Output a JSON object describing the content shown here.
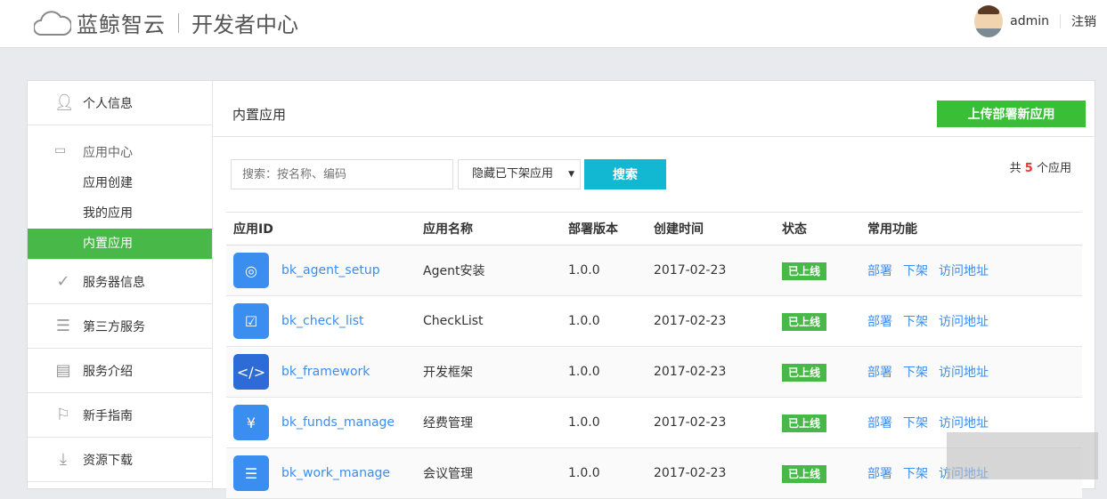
{
  "header": {
    "brand": "蓝鲸智云",
    "subtitle": "开发者中心",
    "username": "admin",
    "logout": "注销"
  },
  "sidebar": {
    "personal": "个人信息",
    "app_center": {
      "label": "应用中心",
      "items": [
        "应用创建",
        "我的应用",
        "内置应用"
      ],
      "active": 2
    },
    "items": [
      {
        "label": "服务器信息",
        "icon": "check-circle-icon"
      },
      {
        "label": "第三方服务",
        "icon": "list-icon"
      },
      {
        "label": "服务介绍",
        "icon": "document-icon"
      },
      {
        "label": "新手指南",
        "icon": "signpost-icon"
      },
      {
        "label": "资源下载",
        "icon": "download-icon"
      }
    ]
  },
  "main": {
    "title": "内置应用",
    "upload_button": "上传部署新应用",
    "search_placeholder": "搜索：按名称、编码",
    "filter": "隐藏已下架应用",
    "search_button": "搜索",
    "count_prefix": "共",
    "count": "5",
    "count_suffix": "个应用",
    "columns": [
      "应用ID",
      "应用名称",
      "部署版本",
      "创建时间",
      "状态",
      "常用功能"
    ],
    "rows": [
      {
        "id": "bk_agent_setup",
        "name": "Agent安装",
        "version": "1.0.0",
        "created": "2017-02-23",
        "status": "已上线",
        "icon": "◎"
      },
      {
        "id": "bk_check_list",
        "name": "CheckList",
        "version": "1.0.0",
        "created": "2017-02-23",
        "status": "已上线",
        "icon": "☑"
      },
      {
        "id": "bk_framework",
        "name": "开发框架",
        "version": "1.0.0",
        "created": "2017-02-23",
        "status": "已上线",
        "icon": "</>"
      },
      {
        "id": "bk_funds_manage",
        "name": "经费管理",
        "version": "1.0.0",
        "created": "2017-02-23",
        "status": "已上线",
        "icon": "¥"
      },
      {
        "id": "bk_work_manage",
        "name": "会议管理",
        "version": "1.0.0",
        "created": "2017-02-23",
        "status": "已上线",
        "icon": "☰"
      }
    ],
    "actions": [
      "部署",
      "下架",
      "访问地址"
    ]
  }
}
